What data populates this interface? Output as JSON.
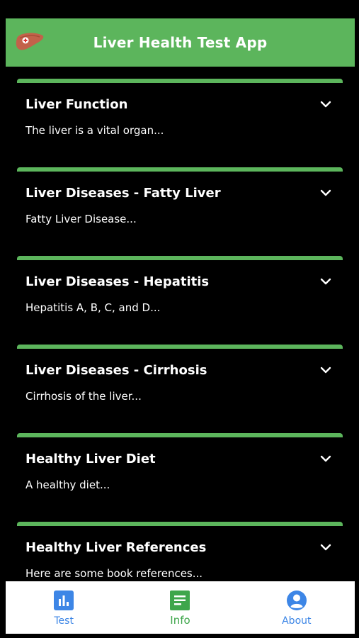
{
  "colors": {
    "accent": "#5cb55c",
    "tab_blue": "#3d86e6",
    "tab_green": "#3ea64b"
  },
  "header": {
    "title": "Liver Health Test App",
    "logo_icon": "liver-icon"
  },
  "cards": [
    {
      "title": "Liver Function",
      "summary": "The liver is a vital organ...",
      "icon": "chevron-down-icon"
    },
    {
      "title": "Liver Diseases - Fatty Liver",
      "summary": "Fatty Liver Disease...",
      "icon": "chevron-down-icon"
    },
    {
      "title": "Liver Diseases - Hepatitis",
      "summary": "Hepatitis A, B, C, and D...",
      "icon": "chevron-down-icon"
    },
    {
      "title": "Liver Diseases - Cirrhosis",
      "summary": "Cirrhosis of the liver...",
      "icon": "chevron-down-icon"
    },
    {
      "title": "Healthy Liver Diet",
      "summary": "A healthy diet...",
      "icon": "chevron-down-icon"
    },
    {
      "title": "Healthy Liver References",
      "summary": "Here are some book references...",
      "icon": "chevron-down-icon"
    }
  ],
  "tabs": [
    {
      "label": "Test",
      "icon": "chart-icon",
      "active": false
    },
    {
      "label": "Info",
      "icon": "document-icon",
      "active": true
    },
    {
      "label": "About",
      "icon": "user-icon",
      "active": false
    }
  ]
}
